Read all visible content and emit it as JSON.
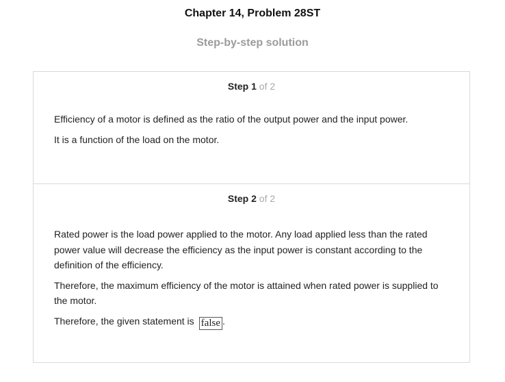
{
  "header": {
    "title": "Chapter 14, Problem 28ST",
    "subtitle": "Step-by-step solution"
  },
  "steps": [
    {
      "label": "Step",
      "number": "1",
      "of": "of 2",
      "paragraphs": [
        "Efficiency of a motor is defined as the ratio of the output power and the input power.",
        "It is a function of the load on the motor."
      ]
    },
    {
      "label": "Step",
      "number": "2",
      "of": "of 2",
      "paragraphs": [
        "Rated power is the load power applied to the motor. Any load applied less than the rated power value will decrease the efficiency as the input power is constant according to the definition of the efficiency.",
        "Therefore, the maximum efficiency of the motor is attained when rated power is supplied to the motor."
      ],
      "conclusion_prefix": "Therefore, the given statement is",
      "answer": "false",
      "conclusion_suffix": "."
    }
  ],
  "colors": {
    "subtitle": "#9b9b9b",
    "border": "#d9d9d9",
    "step_of": "#a8a8a8"
  }
}
